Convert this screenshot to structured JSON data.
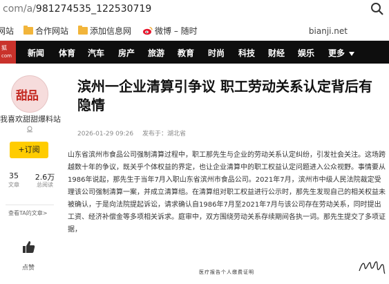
{
  "browser": {
    "url_prefix": "com/a/",
    "url_path": "981274535_122530719"
  },
  "bookmarks": [
    {
      "label": "网站"
    },
    {
      "label": "合作网站"
    },
    {
      "label": "添加信息网"
    },
    {
      "label": "微博 – 随时"
    }
  ],
  "bookmarks_right": "bianji.net",
  "logo": {
    "top": "狐",
    "bottom": "com"
  },
  "nav": {
    "items": [
      "新闻",
      "体育",
      "汽车",
      "房产",
      "旅游",
      "教育",
      "时尚",
      "科技",
      "财经",
      "娱乐"
    ],
    "more": "更多"
  },
  "author": {
    "avatar_text": "甜品",
    "name": "我喜欢甜甜爆料站",
    "follow_label": "+订阅",
    "articles_count": "35",
    "articles_label": "文章",
    "reads_count": "2.6万",
    "reads_label": "总阅读",
    "more_link": "查看TA的文章>"
  },
  "like": {
    "label": "点赞"
  },
  "article": {
    "title": "滨州一企业清算引争议 职工劳动关系认定背后有隐情",
    "date": "2026-01-29 09:26",
    "source": "发布于：湖北省",
    "body": "山东省滨州市食品公司强制清算过程中，职工那先生与企业的劳动关系认定纠纷，引发社会关注。这场跨越数十年的争议，既关乎个体权益的界定，也让企业清算中的职工权益认定问题进入公众视野。事情要从1986年说起，那先生于当年7月入职山东省滨州市食品公司。2021年7月，滨州市中级人民法院裁定受理该公司强制清算一案，并成立清算组。在清算组对职工权益进行公示时，那先生发现自己的相关权益未被确认，于是向法院提起诉讼，请求确认自1986年7月至2021年7月与该公司存在劳动关系，同时提出工资、经济补偿金等多项相关诉求。庭审中，双方围绕劳动关系存续期间各执一词。那先生提交了多项证据，",
    "doc_caption": "医疗报告个人缴费证明"
  },
  "colors": {
    "nav_bg": "#0e0e0e",
    "follow_bg": "#ffcc00",
    "logo_bg": "#c9322b"
  }
}
